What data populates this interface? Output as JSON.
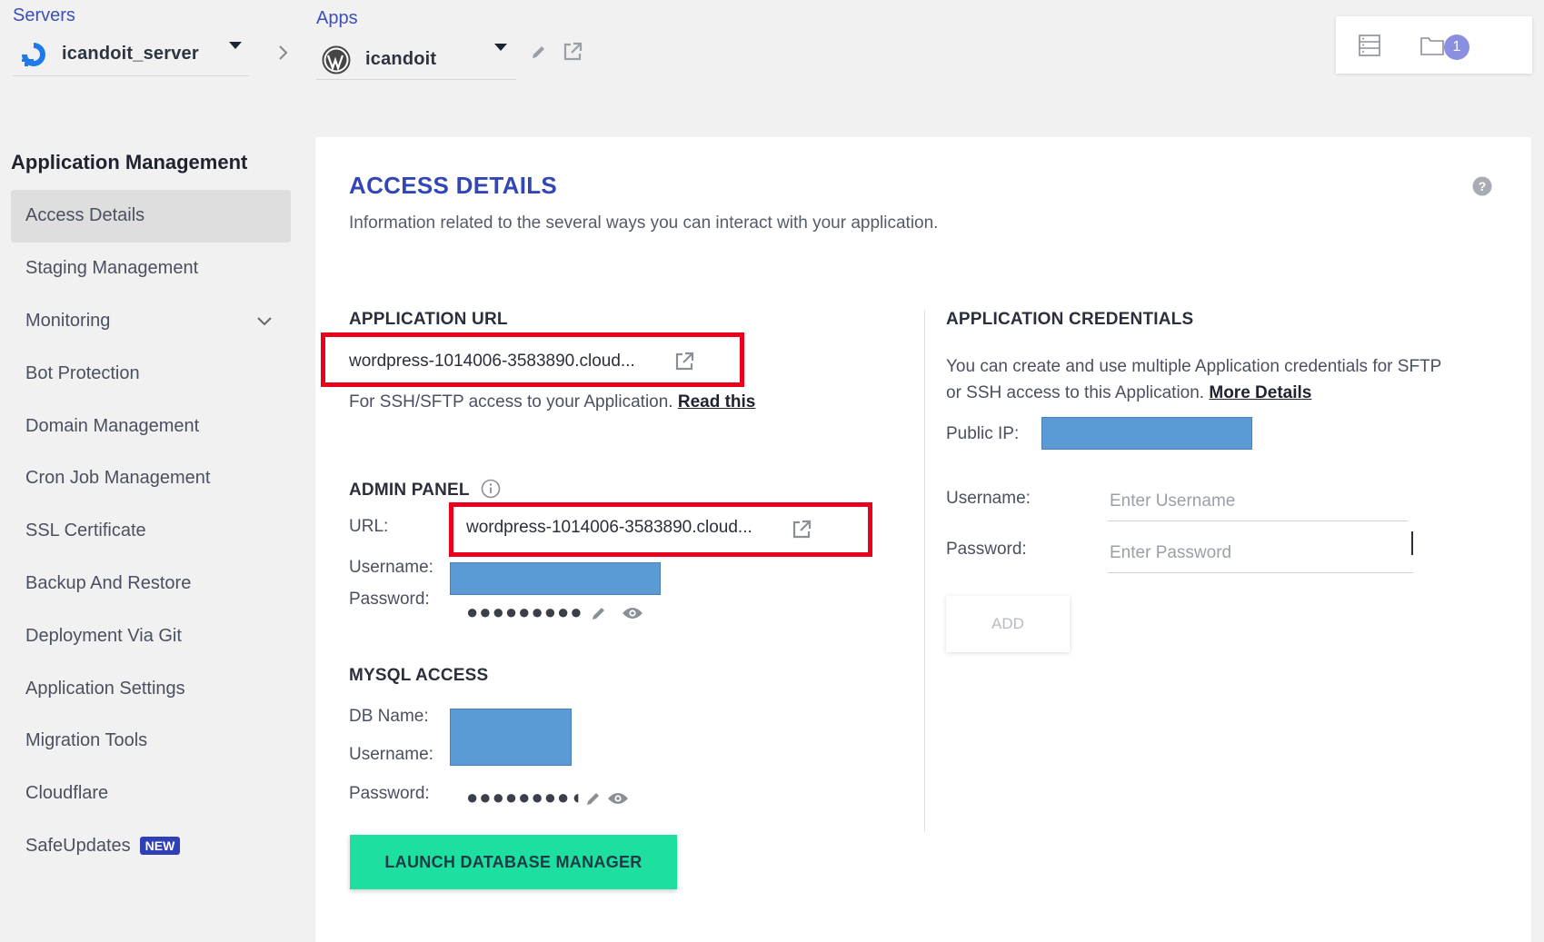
{
  "topbar": {
    "servers_label": "Servers",
    "server_name": "icandoit_server",
    "apps_label": "Apps",
    "app_name": "icandoit",
    "notification_count": "1"
  },
  "sidebar": {
    "title": "Application Management",
    "items": [
      {
        "label": "Access Details"
      },
      {
        "label": "Staging Management"
      },
      {
        "label": "Monitoring"
      },
      {
        "label": "Bot Protection"
      },
      {
        "label": "Domain Management"
      },
      {
        "label": "Cron Job Management"
      },
      {
        "label": "SSL Certificate"
      },
      {
        "label": "Backup And Restore"
      },
      {
        "label": "Deployment Via Git"
      },
      {
        "label": "Application Settings"
      },
      {
        "label": "Migration Tools"
      },
      {
        "label": "Cloudflare"
      },
      {
        "label": "SafeUpdates"
      }
    ],
    "new_badge": "NEW"
  },
  "main": {
    "title": "ACCESS DETAILS",
    "description": "Information related to the several ways you can interact with your application.",
    "app_url": {
      "heading": "APPLICATION URL",
      "url": "wordpress-1014006-3583890.cloud...",
      "ssh_text": "For SSH/SFTP access to your Application.",
      "ssh_link": "Read this"
    },
    "admin_panel": {
      "heading": "ADMIN PANEL",
      "url_label": "URL:",
      "url": "wordpress-1014006-3583890.cloud...",
      "username_label": "Username:",
      "password_label": "Password:",
      "password_mask": "●●●●●●●●●"
    },
    "mysql": {
      "heading": "MYSQL ACCESS",
      "dbname_label": "DB Name:",
      "username_label": "Username:",
      "password_label": "Password:",
      "password_mask": "●●●●●●●●◖",
      "launch_button": "LAUNCH DATABASE MANAGER"
    },
    "credentials": {
      "heading": "APPLICATION CREDENTIALS",
      "description_line1": "You can create and use multiple Application credentials for SFTP",
      "description_line2": "or SSH access to this Application.",
      "more_link": "More Details",
      "public_ip_label": "Public IP:",
      "username_label": "Username:",
      "username_placeholder": "Enter Username",
      "password_label": "Password:",
      "password_placeholder": "Enter Password",
      "add_button": "ADD"
    }
  },
  "colors": {
    "accent": "#3247b5",
    "highlight_box": "#e8001c",
    "redaction": "#5b9bd5",
    "launch_button": "#1de0a0"
  }
}
